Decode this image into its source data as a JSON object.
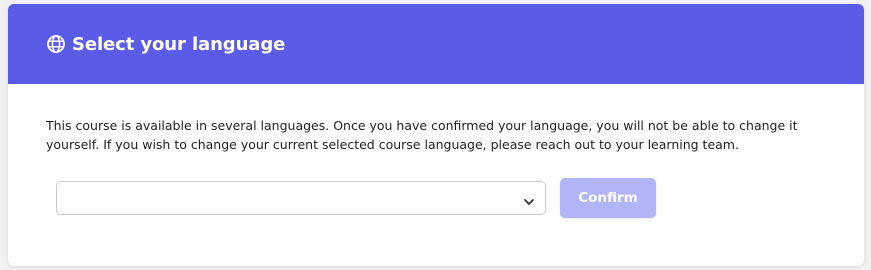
{
  "dialog": {
    "title": "Select your language",
    "title_icon": "globe-icon",
    "description": "This course is available in several languages. Once you have confirmed your language, you will not be able to change it yourself. If you wish to change your current selected course language, please reach out to your learning team.",
    "language_select": {
      "value": "",
      "icon": "chevron-down-icon"
    },
    "confirm_label": "Confirm"
  },
  "colors": {
    "header_bg": "#5b5be8",
    "confirm_bg_disabled": "#b3b3f7",
    "text": "#1f1f1f"
  }
}
